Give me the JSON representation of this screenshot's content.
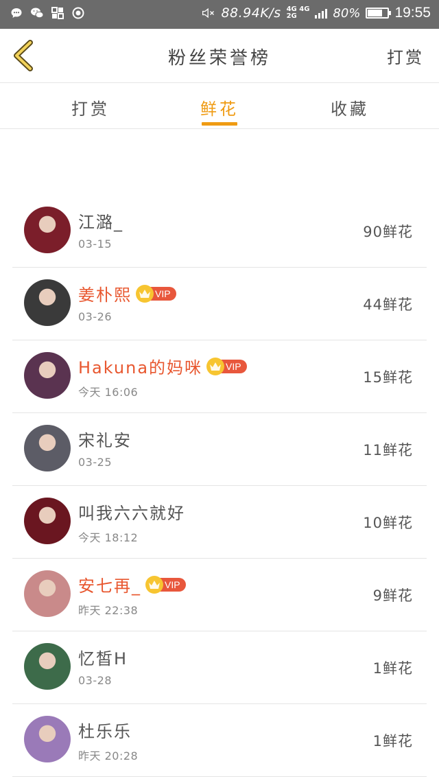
{
  "status_bar": {
    "net_speed": "88.94K/s",
    "net_type_top": "4G 4G",
    "net_type_bottom": "2G",
    "battery_percent": "80%",
    "battery_level": 0.8,
    "time": "19:55",
    "icons": [
      "chat-bubble-icon",
      "wechat-icon",
      "app-grid-icon",
      "record-icon",
      "mute-icon",
      "signal-icon",
      "battery-icon"
    ]
  },
  "header": {
    "title": "粉丝荣誉榜",
    "action_label": "打赏"
  },
  "tabs": [
    {
      "label": "打赏",
      "active": false
    },
    {
      "label": "鲜花",
      "active": true
    },
    {
      "label": "收藏",
      "active": false
    }
  ],
  "fans": [
    {
      "name": "江潞_",
      "date": "03-15",
      "amount": "90鲜花",
      "vip": false,
      "avatar_color": "#7b1e2a"
    },
    {
      "name": "姜朴熙",
      "date": "03-26",
      "amount": "44鲜花",
      "vip": true,
      "vip_label": "VIP",
      "avatar_color": "#3a3a3a"
    },
    {
      "name": "Hakuna的妈咪",
      "date": "今天 16:06",
      "amount": "15鲜花",
      "vip": true,
      "vip_label": "VIP",
      "avatar_color": "#5a3350"
    },
    {
      "name": "宋礼安",
      "date": "03-25",
      "amount": "11鲜花",
      "vip": false,
      "avatar_color": "#5c5c66"
    },
    {
      "name": "叫我六六就好",
      "date": "今天 18:12",
      "amount": "10鲜花",
      "vip": false,
      "avatar_color": "#6a1620"
    },
    {
      "name": "安七再_",
      "date": "昨天 22:38",
      "amount": "9鲜花",
      "vip": true,
      "vip_label": "VIP",
      "avatar_color": "#c98a8a"
    },
    {
      "name": "忆皙H",
      "date": "03-28",
      "amount": "1鲜花",
      "vip": false,
      "avatar_color": "#3d6b4a"
    },
    {
      "name": "杜乐乐",
      "date": "昨天 20:28",
      "amount": "1鲜花",
      "vip": false,
      "avatar_color": "#9a7ab8"
    }
  ]
}
